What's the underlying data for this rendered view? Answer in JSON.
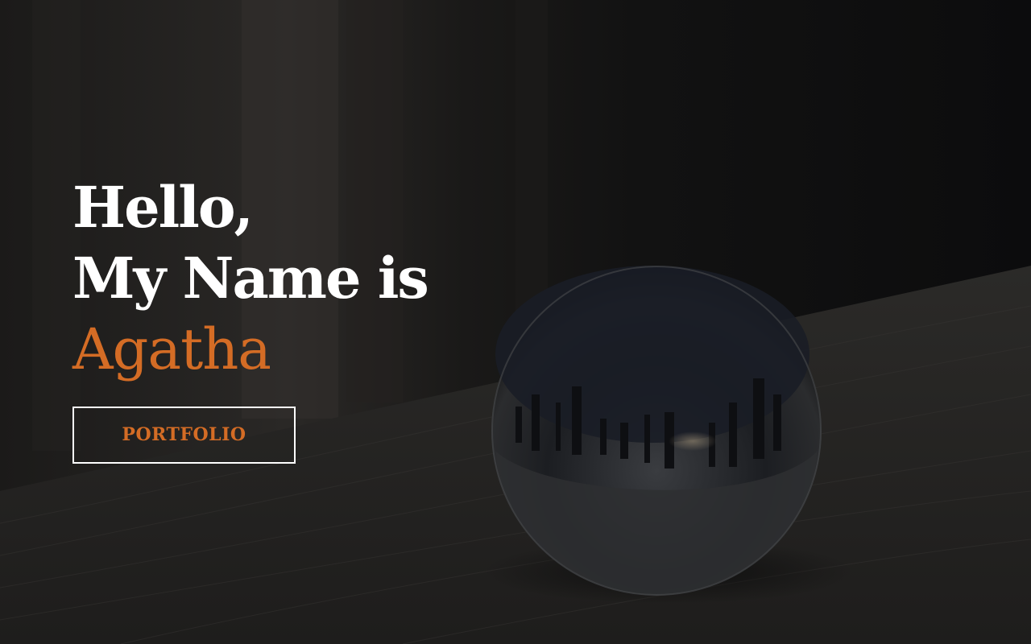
{
  "hero": {
    "greeting": "Hello,",
    "intro": "My Name is",
    "name": "Agatha",
    "button_label": "PORTFOLIO"
  },
  "colors": {
    "accent": "#d46c25",
    "text": "#ffffff",
    "background": "#0f0f10"
  }
}
